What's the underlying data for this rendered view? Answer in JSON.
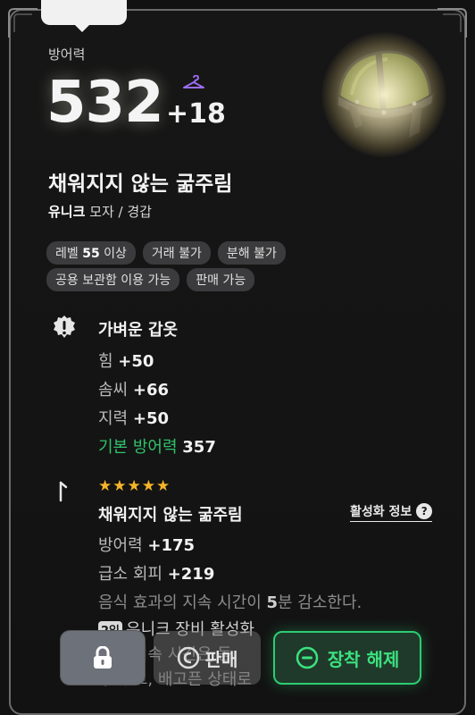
{
  "header": {
    "defense_label": "방어력",
    "defense_value": "532",
    "defense_bonus": "+18"
  },
  "item": {
    "name": "채워지지 않는 굶주림",
    "grade": "유니크",
    "type": "모자 / 경갑"
  },
  "tags": {
    "level_prefix": "레벨",
    "level_value": "55",
    "level_suffix": "이상",
    "trade": "거래 불가",
    "disassemble": "분해 불가",
    "shared_storage": "공용 보관함 이용 가능",
    "sellable": "판매 가능"
  },
  "stats_section": {
    "title": "가벼운 갑옷",
    "stats": [
      {
        "label": "힘",
        "value": "+50"
      },
      {
        "label": "솜씨",
        "value": "+66"
      },
      {
        "label": "지력",
        "value": "+50"
      }
    ],
    "base_label": "기본 방어력",
    "base_value": "357"
  },
  "set_section": {
    "stars": "★★★★★",
    "title": "채워지지 않는 굶주림",
    "activation_label": "활성화 정보",
    "stats": [
      {
        "label": "방어력",
        "value": "+175"
      },
      {
        "label": "급소 회피",
        "value": "+219"
      }
    ],
    "desc_1_prefix": "음식 효과의 지속 시간이",
    "desc_1_value": "5",
    "desc_1_suffix": "분 감소한다.",
    "tag": "2일",
    "desc_2": "유니크 장비 활성화",
    "desc_3": "효과 지속 시간은 동",
    "desc_4": "수 있고, 배고픈 상태로"
  },
  "buttons": {
    "sell": "판매",
    "unequip": "장착 해제"
  },
  "colors": {
    "accent_green": "#2dcc72",
    "star": "#f5b52a",
    "hanger": "#9b6cf0"
  }
}
